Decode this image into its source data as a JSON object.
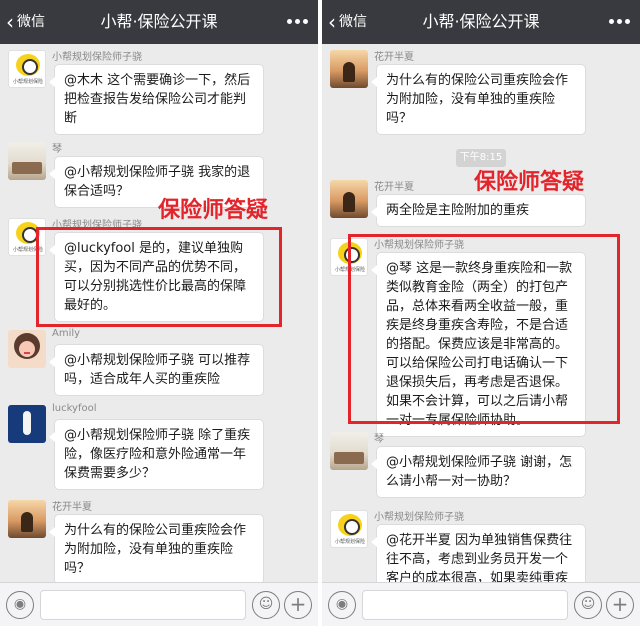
{
  "header": {
    "back_label": "微信",
    "title": "小帮·保险公开课"
  },
  "overlay_label": "保险师答疑",
  "left_messages": [
    {
      "sender": "小帮规划保险师子骁",
      "avatar_caption": "小帮规划保险",
      "text": "@木木 这个需要确诊一下，然后把检查报告发给保险公司才能判断"
    },
    {
      "sender": "琴",
      "text": "@小帮规划保险师子骁 我家的退保合适吗？"
    },
    {
      "sender": "小帮规划保险师子骁",
      "avatar_caption": "小帮规划保险",
      "text": "@luckyfool 是的，建议单独购买，因为不同产品的优势不同，可以分别挑选性价比最高的保障最好的。"
    },
    {
      "sender": "Amily",
      "text": "@小帮规划保险师子骁 可以推荐吗，适合成年人买的重疾险"
    },
    {
      "sender": "luckyfool",
      "text": "@小帮规划保险师子骁 除了重疾险，像医疗险和意外险通常一年保费需要多少？"
    },
    {
      "sender": "花开半夏",
      "text": "为什么有的保险公司重疾险会作为附加险，没有单独的重疾险吗？"
    }
  ],
  "right_messages": [
    {
      "sender": "花开半夏",
      "text": "为什么有的保险公司重疾险会作为附加险，没有单独的重疾险吗？"
    },
    {
      "sender": "花开半夏",
      "text": "两全险是主险附加的重疾"
    },
    {
      "sender": "小帮规划保险师子骁",
      "avatar_caption": "小帮规划保险",
      "text": "@琴 这是一款终身重疾险和一款类似教育金险（两全）的打包产品，总体来看两全收益一般，重疾是终身重疾含寿险，不是合适的搭配。保费应该是非常高的。可以给保险公司打电话确认一下退保损失后，再考虑是否退保。如果不会计算，可以之后请小帮一对一专属保险师协助。"
    },
    {
      "sender": "琴",
      "text": "@小帮规划保险师子骁 谢谢，怎么请小帮一对一协助？"
    },
    {
      "sender": "小帮规划保险师子骁",
      "avatar_caption": "小帮规划保险",
      "text": "@花开半夏 因为单独销售保费往往不高，考虑到业务员开发一个客户的成本很高，如果卖纯重疾"
    }
  ],
  "timestamp": "下午8:15",
  "colors": {
    "header_bg": "#393a3f",
    "chat_bg": "#ebebeb",
    "highlight_red": "#e3242b"
  }
}
